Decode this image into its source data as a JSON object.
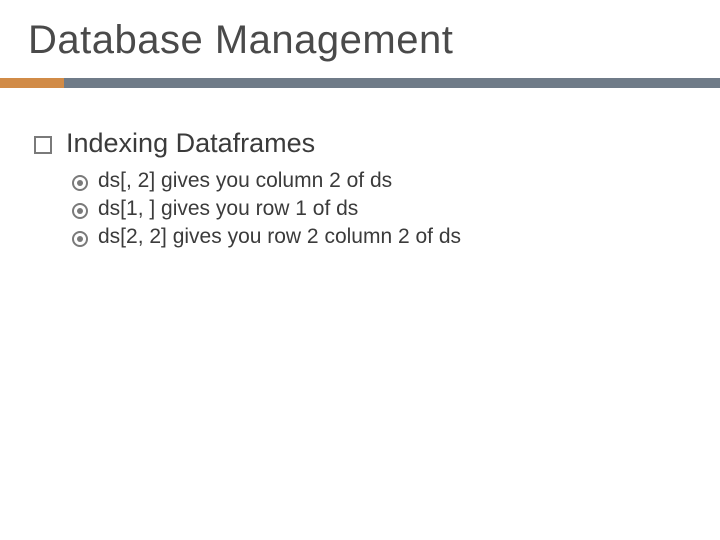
{
  "title": "Database Management",
  "heading": "Indexing Dataframes",
  "items": [
    "ds[, 2] gives you column 2 of ds",
    "ds[1, ] gives you row 1 of ds",
    "ds[2, 2] gives you row 2 column 2 of ds"
  ]
}
